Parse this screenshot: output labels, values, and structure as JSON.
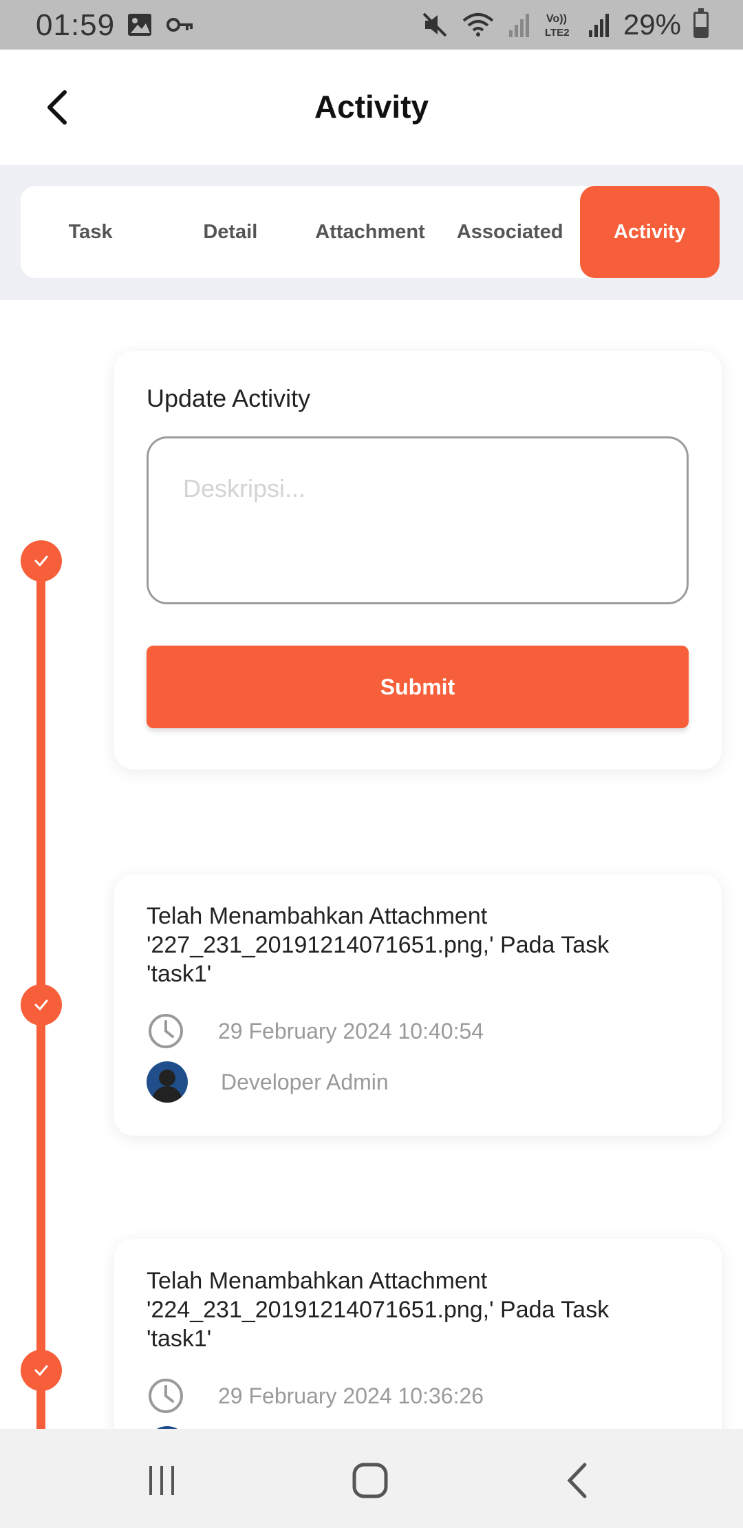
{
  "status_bar": {
    "time": "01:59",
    "battery": "29%",
    "icons": [
      "image-icon",
      "key-icon",
      "mute-icon",
      "wifi-icon",
      "signal-icon",
      "volte-icon",
      "signal-icon",
      "battery-icon"
    ]
  },
  "header": {
    "title": "Activity",
    "back_icon": "chevron-left-icon"
  },
  "tabs": [
    {
      "label": "Task",
      "active": false
    },
    {
      "label": "Detail",
      "active": false
    },
    {
      "label": "Attachment",
      "active": false
    },
    {
      "label": "Associated",
      "active": false
    },
    {
      "label": "Activity",
      "active": true
    }
  ],
  "update_form": {
    "title": "Update Activity",
    "placeholder": "Deskripsi...",
    "submit_label": "Submit"
  },
  "activities": [
    {
      "text": "Telah Menambahkan Attachment '227_231_20191214071651.png,' Pada Task 'task1'",
      "timestamp": "29 February 2024 10:40:54",
      "user": "Developer Admin"
    },
    {
      "text": "Telah Menambahkan Attachment '224_231_20191214071651.png,' Pada Task 'task1'",
      "timestamp": "29 February 2024 10:36:26",
      "user": ""
    }
  ],
  "colors": {
    "accent": "#f75f3a",
    "tab_strip_bg": "#eef0f5",
    "meta_text": "#9a9a9a"
  },
  "nav_bar": {
    "icons": [
      "recent-apps-icon",
      "home-icon",
      "back-icon"
    ]
  }
}
